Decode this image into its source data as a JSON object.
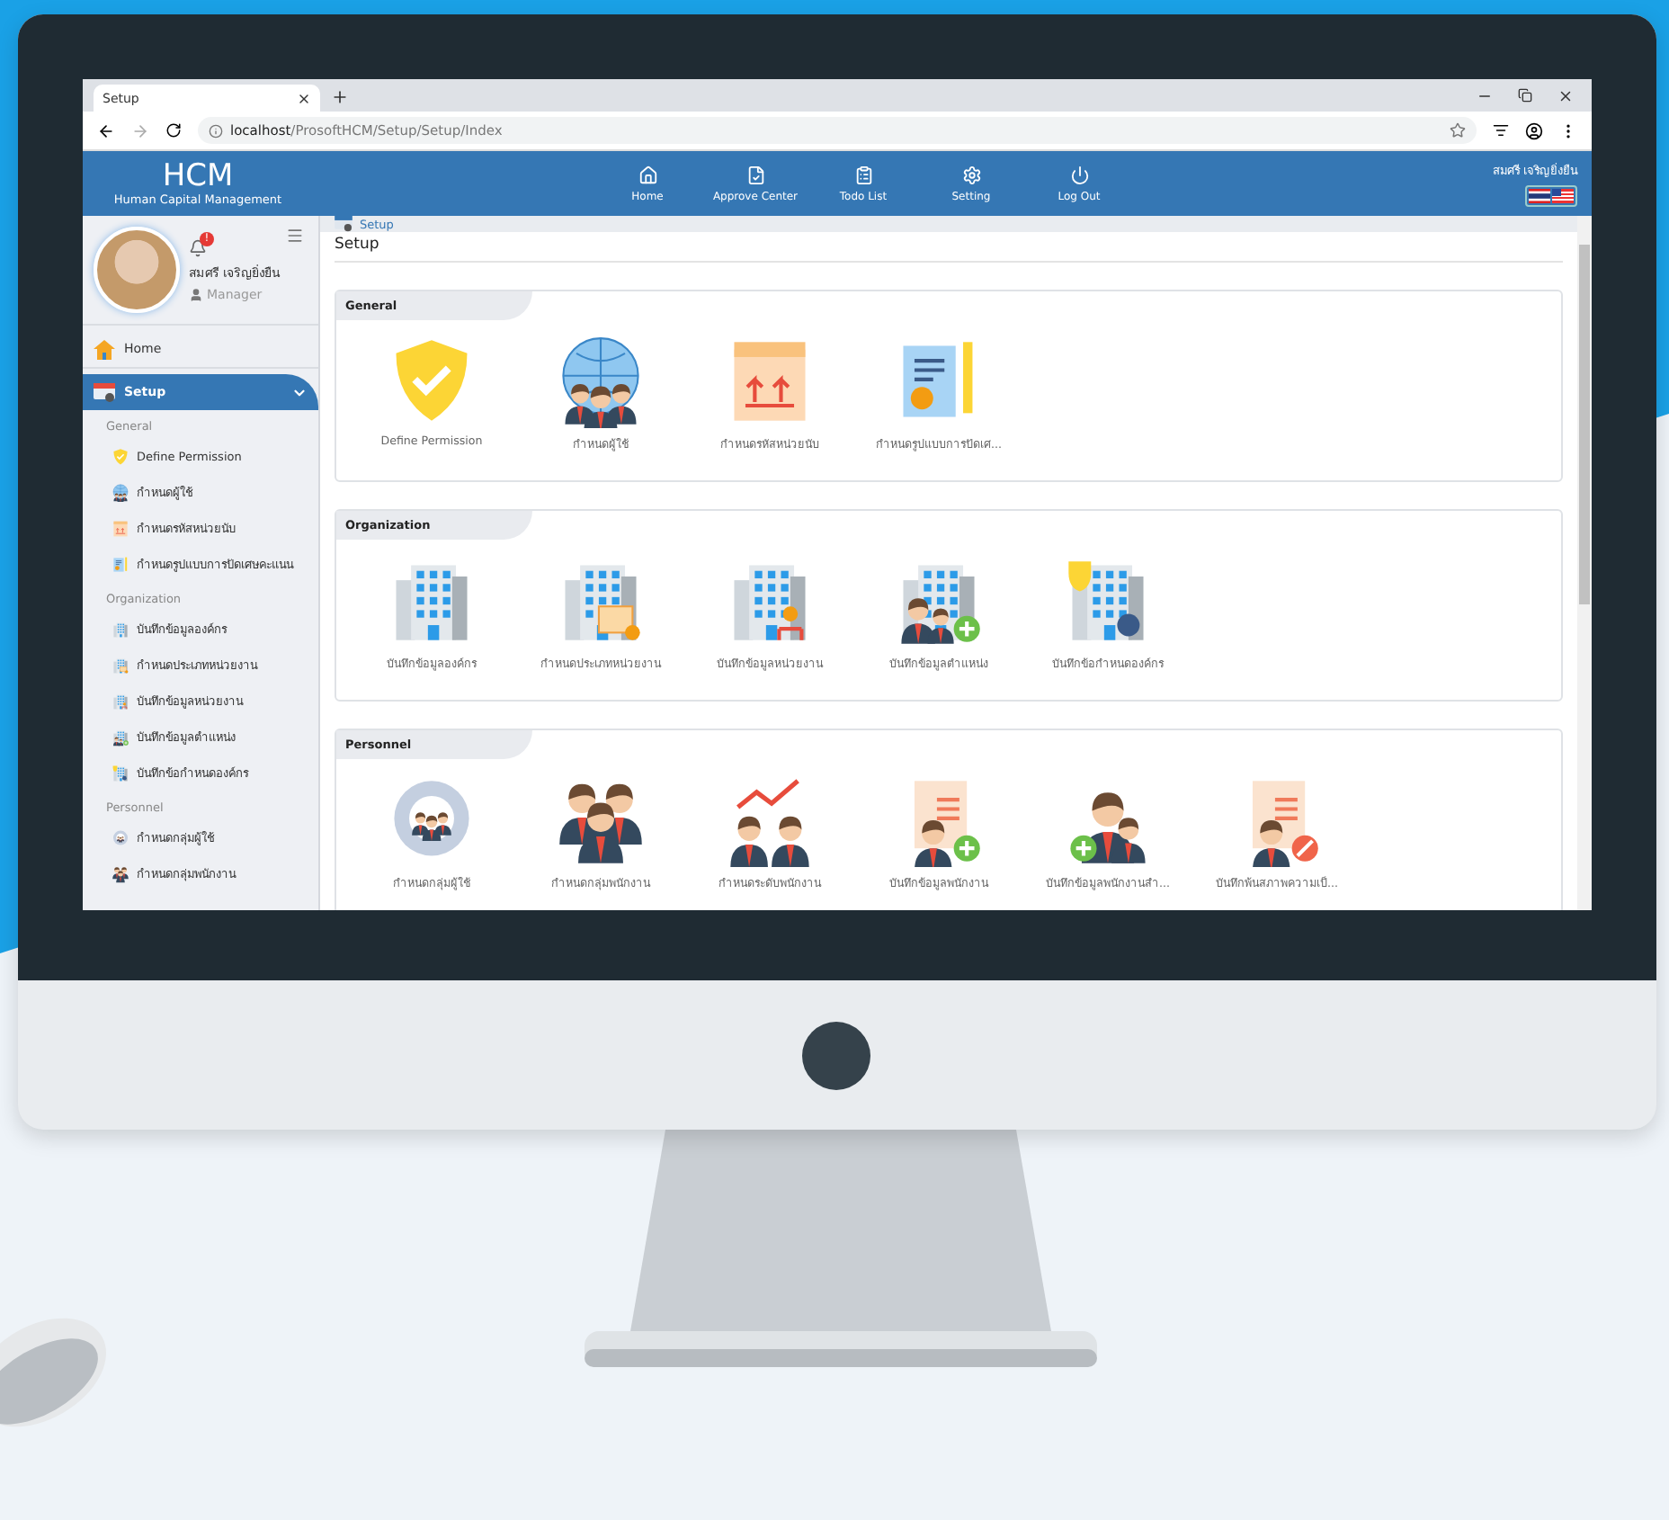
{
  "browser": {
    "tab_title": "Setup",
    "url_host": "localhost",
    "url_path": "/ProsoftHCM/Setup/Setup/Index"
  },
  "header": {
    "logo": "HCM",
    "logo_subtitle": "Human Capital Management",
    "user_name": "สมศรี เจริญยิ่งยืน",
    "nav": [
      {
        "label": "Home"
      },
      {
        "label": "Approve Center"
      },
      {
        "label": "Todo List"
      },
      {
        "label": "Setting"
      },
      {
        "label": "Log Out"
      }
    ]
  },
  "profile": {
    "name": "สมศรี เจริญยิ่งยืน",
    "role": "Manager",
    "notification_badge": "!"
  },
  "menu": [
    {
      "label": "Home",
      "selected": false,
      "expanded": false
    },
    {
      "label": "Setup",
      "selected": true,
      "expanded": true
    }
  ],
  "menu_groups": [
    {
      "title": "General",
      "items": [
        "Define Permission",
        "กำหนดผู้ใช้",
        "กำหนดรหัสหน่วยนับ",
        "กำหนดรูปแบบการปัดเศษคะแนน"
      ]
    },
    {
      "title": "Organization",
      "items": [
        "บันทึกข้อมูลองค์กร",
        "กำหนดประเภทหน่วยงาน",
        "บันทึกข้อมูลหน่วยงาน",
        "บันทึกข้อมูลตำแหน่ง",
        "บันทึกข้อกำหนดองค์กร"
      ]
    },
    {
      "title": "Personnel",
      "items": [
        "กำหนดกลุ่มผู้ใช้",
        "กำหนดกลุ่มพนักงาน"
      ]
    }
  ],
  "breadcrumb": "Setup",
  "page_title": "Setup",
  "sections": [
    {
      "title": "General",
      "items": [
        "Define Permission",
        "กำหนดผู้ใช้",
        "กำหนดรหัสหน่วยนับ",
        "กำหนดรูปแบบการปัดเศ..."
      ]
    },
    {
      "title": "Organization",
      "items": [
        "บันทึกข้อมูลองค์กร",
        "กำหนดประเภทหน่วยงาน",
        "บันทึกข้อมูลหน่วยงาน",
        "บันทึกข้อมูลตำแหน่ง",
        "บันทึกข้อกำหนดองค์กร"
      ]
    },
    {
      "title": "Personnel",
      "items": [
        "กำหนดกลุ่มผู้ใช้",
        "กำหนดกลุ่มพนักงาน",
        "กำหนดระดับพนักงาน",
        "บันทึกข้อมูลพนักงาน",
        "บันทึกข้อมูลพนักงานสำ...",
        "บันทึกพ้นสภาพความเป็..."
      ]
    }
  ]
}
